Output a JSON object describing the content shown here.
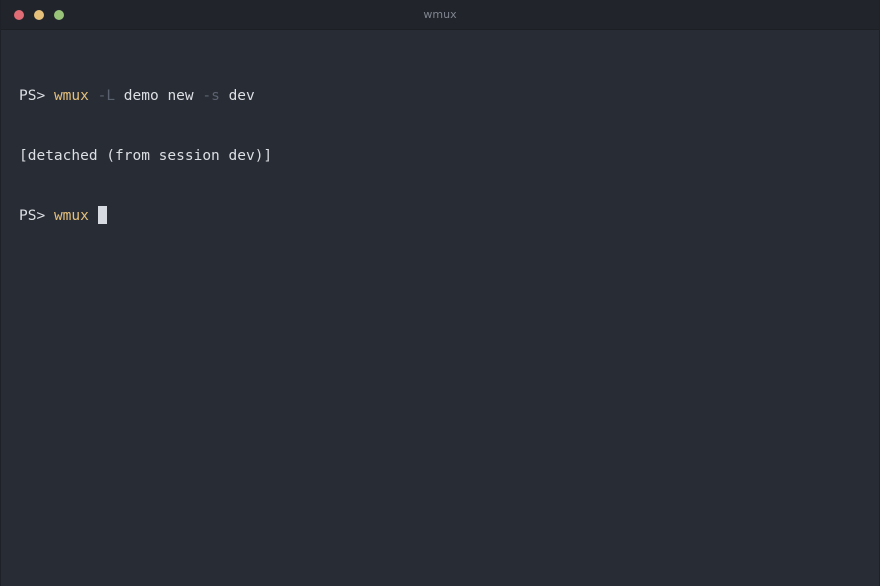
{
  "window": {
    "title": "wmux",
    "traffic_lights": {
      "close_color": "#e06c75",
      "minimize_color": "#e5c07b",
      "maximize_color": "#98c379"
    }
  },
  "terminal": {
    "colors": {
      "background": "#282c34",
      "text": "#dcdfe4",
      "command": "#e5c07b",
      "flag": "#5c6370"
    },
    "lines": [
      {
        "prompt": "PS>",
        "command": "wmux",
        "flag1": "-L",
        "arg1": "demo new",
        "flag2": "-s",
        "arg2": "dev"
      },
      {
        "output": "[detached (from session dev)]"
      },
      {
        "prompt": "PS>",
        "command": "wmux",
        "cursor_icon": "block-cursor"
      }
    ]
  }
}
